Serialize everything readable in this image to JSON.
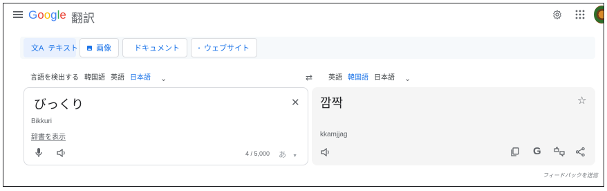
{
  "header": {
    "logo_letters": [
      "G",
      "o",
      "o",
      "g",
      "l",
      "e"
    ],
    "product": "翻訳",
    "icons": [
      "menu-icon",
      "settings-icon",
      "apps-icon",
      "avatar"
    ]
  },
  "type_tabs": [
    {
      "label": "テキスト",
      "icon": "translate-icon",
      "active": true
    },
    {
      "label": "画像",
      "icon": "image-icon",
      "active": false
    },
    {
      "label": "ドキュメント",
      "icon": "document-icon",
      "active": false
    },
    {
      "label": "ウェブサイト",
      "icon": "website-icon",
      "active": false
    }
  ],
  "source_langs": [
    "言語を検出する",
    "韓国語",
    "英語",
    "日本語"
  ],
  "source_selected": "日本語",
  "target_langs": [
    "英語",
    "韓国語",
    "日本語"
  ],
  "target_selected": "韓国語",
  "source": {
    "text": "びっくり",
    "romanization": "Bikkuri",
    "dictionary_link": "辞書を表示",
    "char_count": "4 / 5,000",
    "ime_label": "あ"
  },
  "target": {
    "text": "깜짝",
    "romanization": "kkamjjag"
  },
  "feedback": "フィードバックを送信",
  "colors": {
    "accent": "#1a73e8",
    "panel_bg": "#f5f5f5",
    "border": "#dadce0"
  }
}
